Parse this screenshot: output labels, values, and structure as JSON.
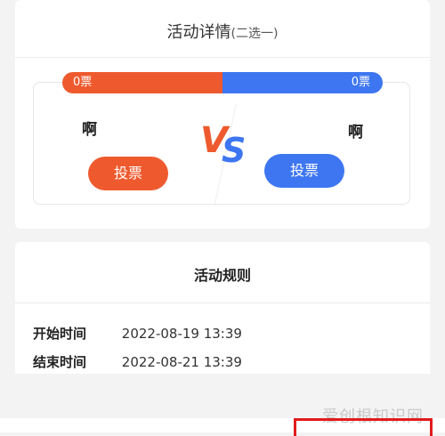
{
  "detail": {
    "title": "活动详情",
    "subtitle": "(二选一)"
  },
  "vote": {
    "left_count": "0票",
    "right_count": "0票",
    "left_share": 0.5,
    "right_share": 0.5,
    "left_name": "啊",
    "right_name": "啊",
    "vs_v": "V",
    "vs_s": "S",
    "left_button": "投票",
    "right_button": "投票",
    "colors": {
      "left": "#ee5a2e",
      "right": "#3d76f0"
    }
  },
  "rules": {
    "title": "活动规则",
    "start_label": "开始时间",
    "start_value": "2022-08-19 13:39",
    "end_label": "结束时间",
    "end_value": "2022-08-21 13:39"
  },
  "watermark": "爱创根知识网"
}
